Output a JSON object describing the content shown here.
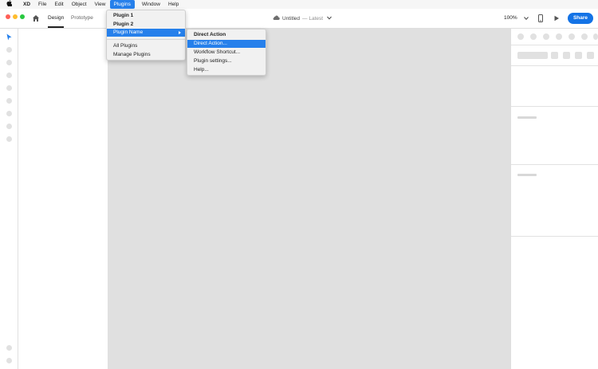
{
  "menubar": {
    "items": [
      {
        "label": "XD",
        "kind": "app"
      },
      {
        "label": "File"
      },
      {
        "label": "Edit"
      },
      {
        "label": "Object"
      },
      {
        "label": "View"
      },
      {
        "label": "Plugins",
        "active": true
      },
      {
        "label": "Window"
      },
      {
        "label": "Help"
      }
    ]
  },
  "toolbar": {
    "tabs": {
      "design": "Design",
      "prototype": "Prototype"
    },
    "doc_title": "Untitled",
    "doc_status": "— Latest",
    "zoom": "100%",
    "share_label": "Share"
  },
  "plugins_menu": {
    "items": [
      {
        "label": "Plugin 1"
      },
      {
        "label": "Plugin 2"
      },
      {
        "label": "Plugin Name"
      },
      {
        "label": "All Plugins"
      },
      {
        "label": "Manage Plugins"
      }
    ]
  },
  "submenu": {
    "items": [
      {
        "label": "Direct Action"
      },
      {
        "label": "Direct Action..."
      },
      {
        "label": "Workflow Shortcut..."
      },
      {
        "label": "Plugin settings..."
      },
      {
        "label": "Help..."
      }
    ]
  },
  "colors": {
    "accent": "#2680eb",
    "share": "#1473e6",
    "canvas": "#e0e0e0"
  }
}
